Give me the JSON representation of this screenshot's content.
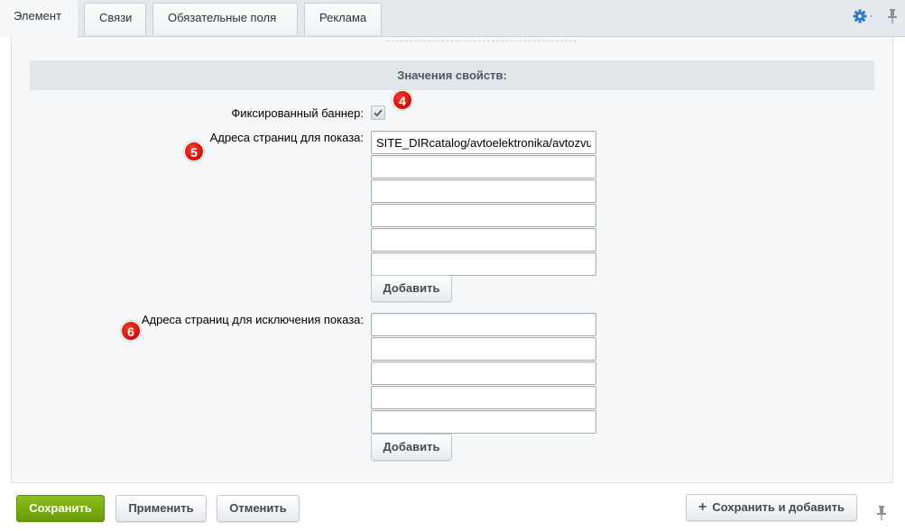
{
  "tabs": [
    {
      "label": "Элемент",
      "active": true
    },
    {
      "label": "Связи",
      "active": false
    },
    {
      "label": "Обязательные поля",
      "active": false
    },
    {
      "label": "Реклама",
      "active": false
    }
  ],
  "section": {
    "title": "Значения свойств:"
  },
  "fixed_banner": {
    "label": "Фиксированный баннер:",
    "checked": true
  },
  "show_pages": {
    "label": "Адреса страниц для показа:",
    "values": [
      "SITE_DIRcatalog/avtoelektronika/avtozvu",
      "",
      "",
      "",
      "",
      ""
    ],
    "add_label": "Добавить"
  },
  "exclude_pages": {
    "label": "Адреса страниц для исключения показа:",
    "values": [
      "",
      "",
      "",
      "",
      ""
    ],
    "add_label": "Добавить"
  },
  "badges": {
    "b4": "4",
    "b5": "5",
    "b6": "6"
  },
  "footer": {
    "save": "Сохранить",
    "apply": "Применить",
    "cancel": "Отменить",
    "save_add": "Сохранить и добавить"
  },
  "colors": {
    "save_button": "#679a08",
    "badge": "#d10f06",
    "gear": "#2e7bc2"
  },
  "icons": [
    "gear-icon",
    "pin-icon",
    "check-icon",
    "plus-icon"
  ]
}
